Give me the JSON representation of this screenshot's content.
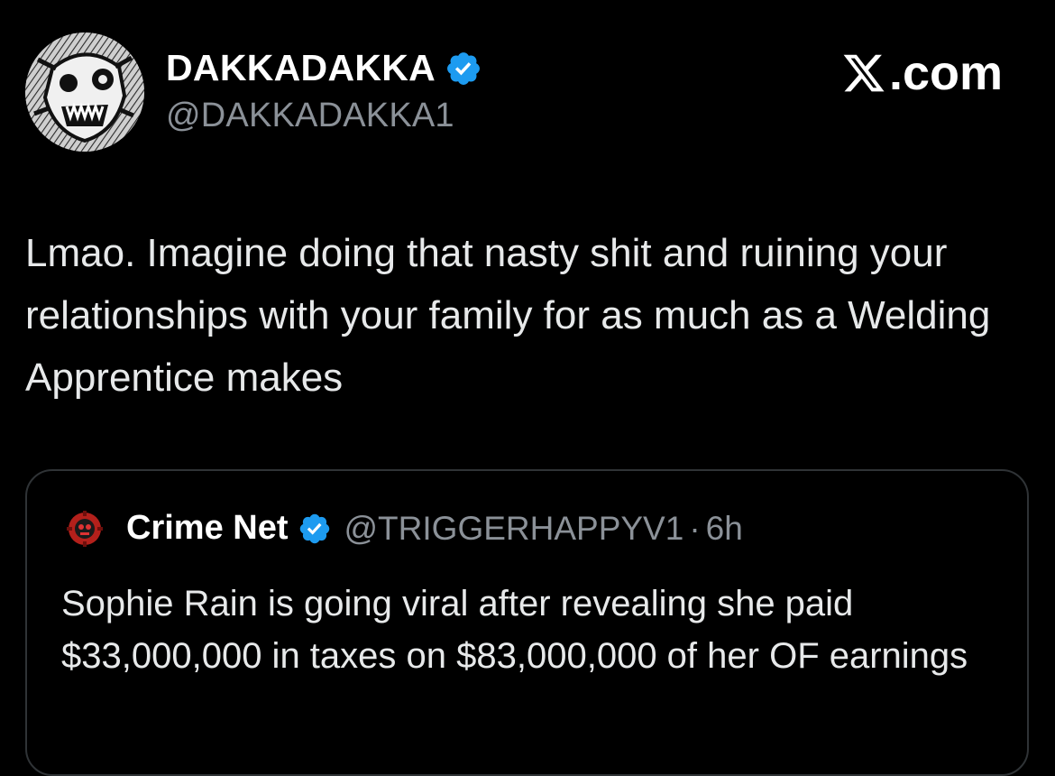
{
  "tweet": {
    "author": {
      "display_name": "DAKKADAKKA",
      "handle": "@DAKKADAKKA1",
      "avatar_icon": "ork-face-avatar",
      "verified_icon": "verified-badge-icon"
    },
    "watermark": {
      "logo_icon": "x-logo-icon",
      "text": ".com"
    },
    "text": "Lmao. Imagine doing that nasty shit and ruining your relationships with your family for as much as a Welding Apprentice makes"
  },
  "quoted_tweet": {
    "avatar_icon": "gear-skull-logo-icon",
    "display_name": "Crime Net",
    "verified_icon": "verified-badge-icon",
    "handle": "@TRIGGERHAPPYV1",
    "separator": "·",
    "time": "6h",
    "text": "Sophie Rain is going viral after revealing she paid $33,000,000 in taxes on $83,000,000 of her OF earnings"
  },
  "colors": {
    "background": "#000000",
    "primary_text": "#e7e9ea",
    "secondary_text": "#8b9198",
    "verified_blue": "#1d9bf0",
    "card_border": "#2f3336"
  }
}
